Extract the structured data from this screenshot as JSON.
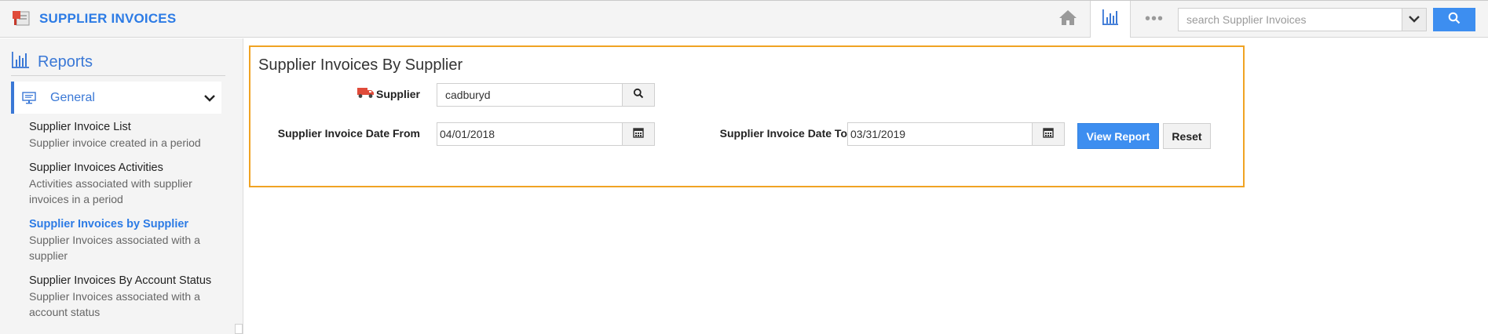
{
  "app": {
    "title": "SUPPLIER INVOICES"
  },
  "topbar": {
    "icons": [
      "home-icon",
      "bar-chart-icon",
      "more-dots-icon",
      "chevron-down-icon",
      "search-icon"
    ],
    "more_label": "•••",
    "search_placeholder": "search Supplier Invoices"
  },
  "sidebar": {
    "title": "Reports",
    "section": "General",
    "items": [
      {
        "title": "Supplier Invoice List",
        "desc": "Supplier invoice created in a period"
      },
      {
        "title": "Supplier Invoices Activities",
        "desc": "Activities associated with supplier invoices in a period"
      },
      {
        "title": "Supplier Invoices by Supplier",
        "desc": "Supplier Invoices associated with a supplier"
      },
      {
        "title": "Supplier Invoices By Account Status",
        "desc": "Supplier Invoices associated with a account status"
      }
    ]
  },
  "report": {
    "title": "Supplier Invoices By Supplier",
    "supplier_label": "Supplier",
    "supplier_value": "cadburyd",
    "date_from_label": "Supplier Invoice Date From",
    "date_from_value": "04/01/2018",
    "date_to_label": "Supplier Invoice Date To",
    "date_to_value": "03/31/2019",
    "view_button": "View Report",
    "reset_button": "Reset"
  },
  "colors": {
    "accent": "#2c7be5",
    "primary_button": "#3d8ef0",
    "panel_border": "#f0a323",
    "truck_icon": "#e04b3a"
  }
}
